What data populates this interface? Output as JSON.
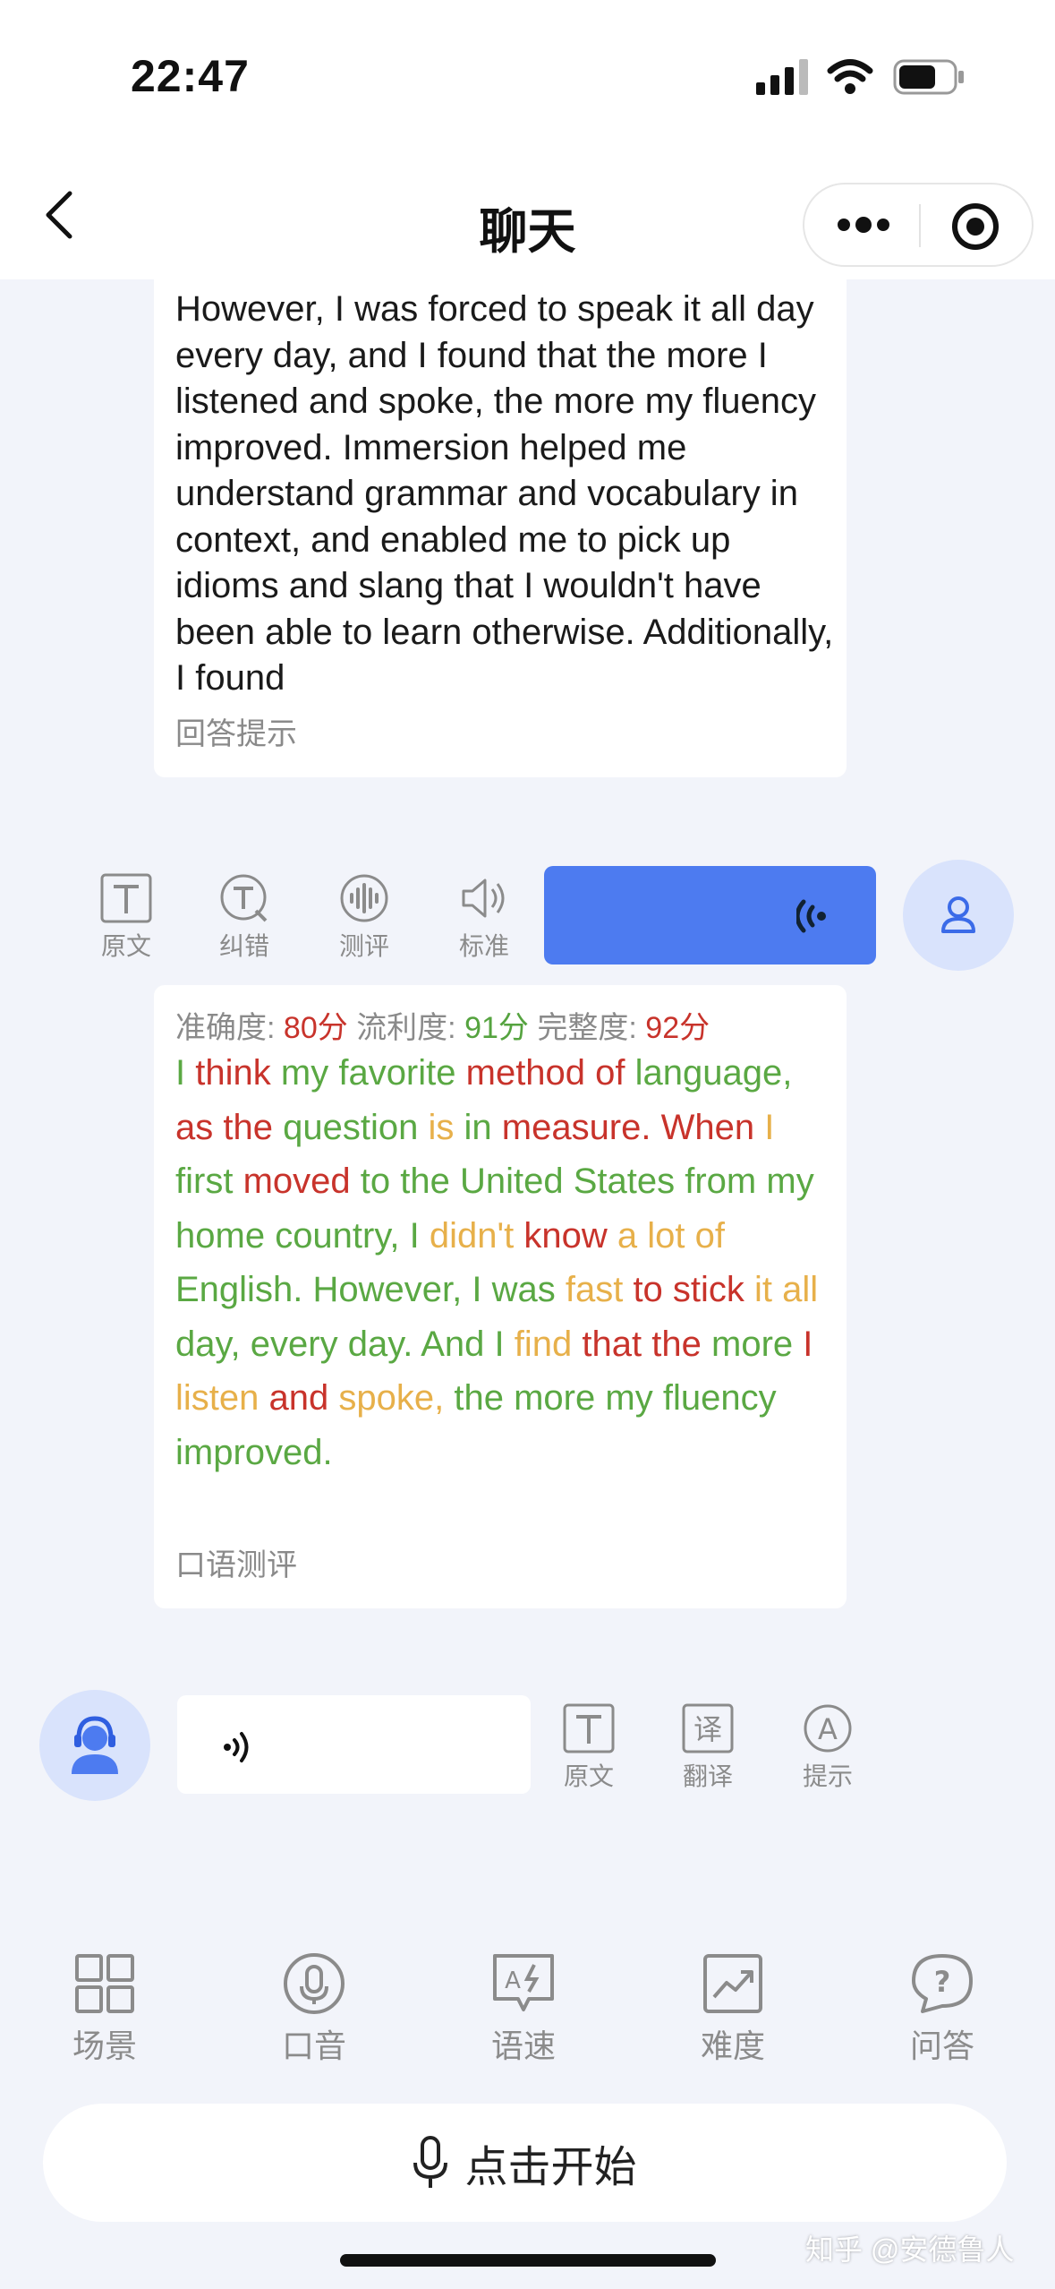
{
  "status_bar": {
    "time": "22:47"
  },
  "header": {
    "title": "聊天"
  },
  "ai_message": {
    "text": "However, I was forced to speak it all day every day, and I found that the more I listened and spoke, the more my fluency improved. Immersion helped me understand grammar and vocabulary in context, and enabled me to pick up idioms and slang that I wouldn't have been able to learn otherwise. Additionally, I found",
    "hint_label": "回答提示"
  },
  "user_tools": [
    {
      "label": "原文",
      "icon": "text-icon"
    },
    {
      "label": "纠错",
      "icon": "correct-icon"
    },
    {
      "label": "测评",
      "icon": "waveform-icon"
    },
    {
      "label": "标准",
      "icon": "speaker-icon"
    }
  ],
  "evaluation": {
    "accuracy_label": "准确度:",
    "accuracy_value": "80分",
    "fluency_label": "流利度:",
    "fluency_value": "91分",
    "completeness_label": "完整度:",
    "completeness_value": "92分",
    "hint_label": "口语测评",
    "words": [
      {
        "t": "I",
        "c": "g"
      },
      {
        "t": "think",
        "c": "r"
      },
      {
        "t": "my",
        "c": "g"
      },
      {
        "t": "favorite",
        "c": "g"
      },
      {
        "t": "method",
        "c": "r"
      },
      {
        "t": "of",
        "c": "r"
      },
      {
        "t": "language,",
        "c": "g"
      },
      {
        "t": "as",
        "c": "r"
      },
      {
        "t": "the",
        "c": "r"
      },
      {
        "t": "question",
        "c": "g"
      },
      {
        "t": "is",
        "c": "o"
      },
      {
        "t": "in",
        "c": "g"
      },
      {
        "t": "measure.",
        "c": "r"
      },
      {
        "t": "When",
        "c": "r"
      },
      {
        "t": "I",
        "c": "o"
      },
      {
        "t": "first",
        "c": "g"
      },
      {
        "t": "moved",
        "c": "r"
      },
      {
        "t": "to",
        "c": "g"
      },
      {
        "t": "the",
        "c": "g"
      },
      {
        "t": "United",
        "c": "g"
      },
      {
        "t": "States",
        "c": "g"
      },
      {
        "t": "from",
        "c": "g"
      },
      {
        "t": "my",
        "c": "g"
      },
      {
        "t": "home",
        "c": "g"
      },
      {
        "t": "country,",
        "c": "g"
      },
      {
        "t": "I",
        "c": "g"
      },
      {
        "t": "didn't",
        "c": "o"
      },
      {
        "t": "know",
        "c": "r"
      },
      {
        "t": "a",
        "c": "o"
      },
      {
        "t": "lot",
        "c": "o"
      },
      {
        "t": "of",
        "c": "o"
      },
      {
        "t": "English.",
        "c": "g"
      },
      {
        "t": "However,",
        "c": "g"
      },
      {
        "t": "I",
        "c": "g"
      },
      {
        "t": "was",
        "c": "g"
      },
      {
        "t": "fast",
        "c": "o"
      },
      {
        "t": "to",
        "c": "r"
      },
      {
        "t": "stick",
        "c": "r"
      },
      {
        "t": "it",
        "c": "o"
      },
      {
        "t": "all",
        "c": "o"
      },
      {
        "t": "day,",
        "c": "g"
      },
      {
        "t": "every",
        "c": "g"
      },
      {
        "t": "day.",
        "c": "g"
      },
      {
        "t": "And",
        "c": "g"
      },
      {
        "t": "I",
        "c": "g"
      },
      {
        "t": "find",
        "c": "o"
      },
      {
        "t": "that",
        "c": "r"
      },
      {
        "t": "the",
        "c": "r"
      },
      {
        "t": "more",
        "c": "g"
      },
      {
        "t": "I",
        "c": "r"
      },
      {
        "t": "listen",
        "c": "o"
      },
      {
        "t": "and",
        "c": "r"
      },
      {
        "t": "spoke,",
        "c": "o"
      },
      {
        "t": "the",
        "c": "g"
      },
      {
        "t": "more",
        "c": "g"
      },
      {
        "t": "my",
        "c": "g"
      },
      {
        "t": "fluency",
        "c": "g"
      },
      {
        "t": "improved.",
        "c": "g"
      }
    ]
  },
  "ai_tools": [
    {
      "label": "原文",
      "icon": "text-icon"
    },
    {
      "label": "翻译",
      "icon": "translate-icon",
      "glyph": "译"
    },
    {
      "label": "提示",
      "icon": "hint-icon",
      "glyph": "A"
    }
  ],
  "bottom_menu": [
    {
      "label": "场景",
      "icon": "grid-icon"
    },
    {
      "label": "口音",
      "icon": "microphone-icon"
    },
    {
      "label": "语速",
      "icon": "speed-icon"
    },
    {
      "label": "难度",
      "icon": "chart-icon"
    },
    {
      "label": "问答",
      "icon": "question-bubble-icon"
    }
  ],
  "start_button": {
    "label": "点击开始"
  },
  "watermark": "知乎 @安德鲁人",
  "colors": {
    "accent": "#4d7bf0",
    "good": "#5aa843",
    "bad": "#c8332b",
    "medium": "#e7b04a"
  }
}
